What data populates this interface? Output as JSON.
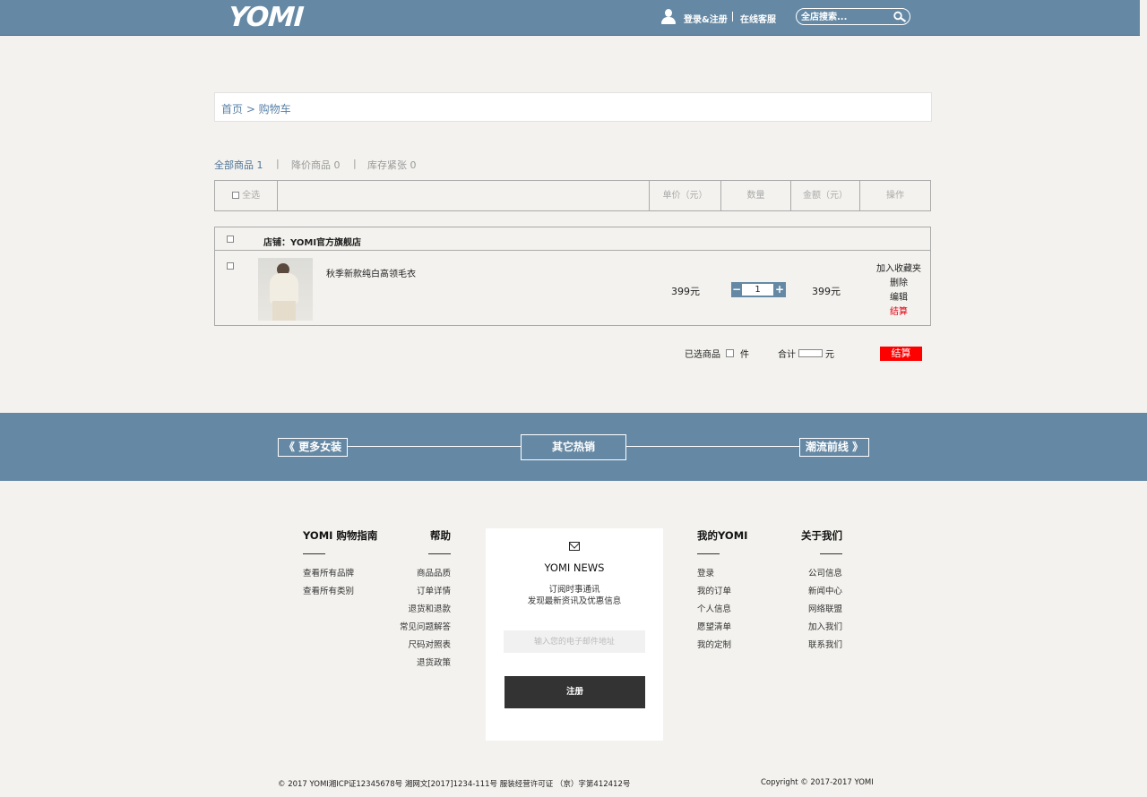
{
  "header": {
    "logo": "YOMI",
    "login_register": "登录&注册",
    "online_service": "在线客服",
    "search_placeholder": "全店搜索..."
  },
  "breadcrumb": "首页 > 购物车",
  "tabs": [
    {
      "label": "全部商品",
      "count": "1"
    },
    {
      "label": "降价商品",
      "count": "0"
    },
    {
      "label": "库存紧张",
      "count": "0"
    }
  ],
  "tab_separator": "|",
  "table_header": {
    "select_all": "全选",
    "unit_price": "单价（元）",
    "quantity": "数量",
    "amount": "金额（元）",
    "operation": "操作"
  },
  "shop": {
    "name": "店铺：YOMI官方旗舰店"
  },
  "cart_item": {
    "name": "秋季新款纯白高领毛衣",
    "unit_price": "399元",
    "quantity": "1",
    "amount": "399元",
    "ops": [
      "加入收藏夹",
      "删除",
      "编辑",
      "结算"
    ]
  },
  "summary": {
    "selected_label": "已选商品",
    "unit": "件",
    "total_label": "合计",
    "currency": "元",
    "checkout": "结算"
  },
  "band": {
    "left": "《  更多女装",
    "center": "其它热销",
    "right": "潮流前线  》"
  },
  "footer": {
    "guide": {
      "title": "YOMI 购物指南",
      "links": [
        "查看所有品牌",
        "查看所有类别"
      ]
    },
    "help": {
      "title": "帮助",
      "links": [
        "商品品质",
        "订单详情",
        "退货和退款",
        "常见问题解答",
        "尺码对照表",
        "退货政策"
      ]
    },
    "news": {
      "title": "YOMI NEWS",
      "desc1": "订阅时事通讯",
      "desc2": "发现最新资讯及优惠信息",
      "email_placeholder": "输入您的电子邮件地址",
      "register": "注册"
    },
    "my": {
      "title": "我的YOMI",
      "links": [
        "登录",
        "我的订单",
        "个人信息",
        "愿望清单",
        "我的定制"
      ]
    },
    "about": {
      "title": "关于我们",
      "links": [
        "公司信息",
        "新闻中心",
        "网络联盟",
        "加入我们",
        "联系我们"
      ]
    }
  },
  "copyright_left": "© 2017 YOMI湘ICP证12345678号 湘网文[2017]1234-111号   服装经营许可证 （京）字第412412号",
  "copyright_right": "Copyright © 2017-2017 YOMI",
  "colors": {
    "header_bg": "#6589a5",
    "accent_red": "#e60012",
    "page_bg": "#f3f2ee"
  }
}
